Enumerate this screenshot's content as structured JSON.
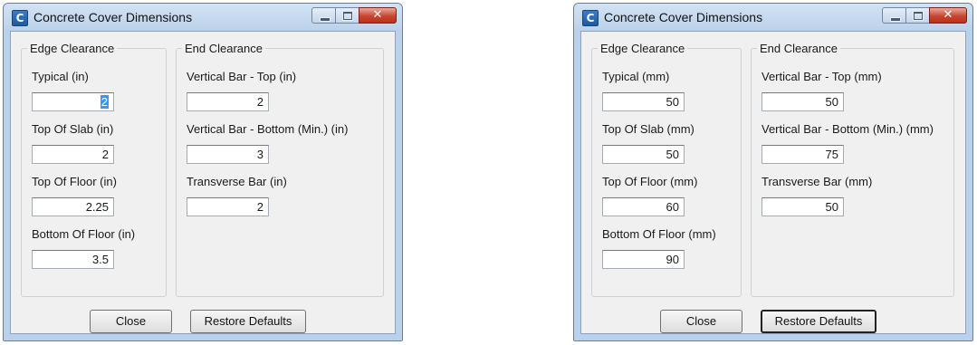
{
  "left_dialog": {
    "title": "Concrete Cover Dimensions",
    "app_icon_glyph": "C",
    "close_glyph": "✕",
    "edge_group": {
      "legend": "Edge Clearance",
      "fields": [
        {
          "label": "Typical (in)",
          "value": "2"
        },
        {
          "label": "Top Of Slab (in)",
          "value": "2"
        },
        {
          "label": "Top Of Floor (in)",
          "value": "2.25"
        },
        {
          "label": "Bottom Of Floor (in)",
          "value": "3.5"
        }
      ]
    },
    "end_group": {
      "legend": "End Clearance",
      "fields": [
        {
          "label": "Vertical Bar - Top (in)",
          "value": "2"
        },
        {
          "label": "Vertical Bar - Bottom (Min.) (in)",
          "value": "3"
        },
        {
          "label": "Transverse Bar (in)",
          "value": "2"
        }
      ]
    },
    "buttons": {
      "close": "Close",
      "restore": "Restore Defaults"
    }
  },
  "right_dialog": {
    "title": "Concrete Cover Dimensions",
    "app_icon_glyph": "C",
    "close_glyph": "✕",
    "edge_group": {
      "legend": "Edge Clearance",
      "fields": [
        {
          "label": "Typical (mm)",
          "value": "50"
        },
        {
          "label": "Top Of Slab (mm)",
          "value": "50"
        },
        {
          "label": "Top Of Floor (mm)",
          "value": "60"
        },
        {
          "label": "Bottom Of Floor (mm)",
          "value": "90"
        }
      ]
    },
    "end_group": {
      "legend": "End Clearance",
      "fields": [
        {
          "label": "Vertical Bar - Top (mm)",
          "value": "50"
        },
        {
          "label": "Vertical Bar - Bottom (Min.) (mm)",
          "value": "75"
        },
        {
          "label": "Transverse Bar (mm)",
          "value": "50"
        }
      ]
    },
    "buttons": {
      "close": "Close",
      "restore": "Restore Defaults"
    }
  }
}
